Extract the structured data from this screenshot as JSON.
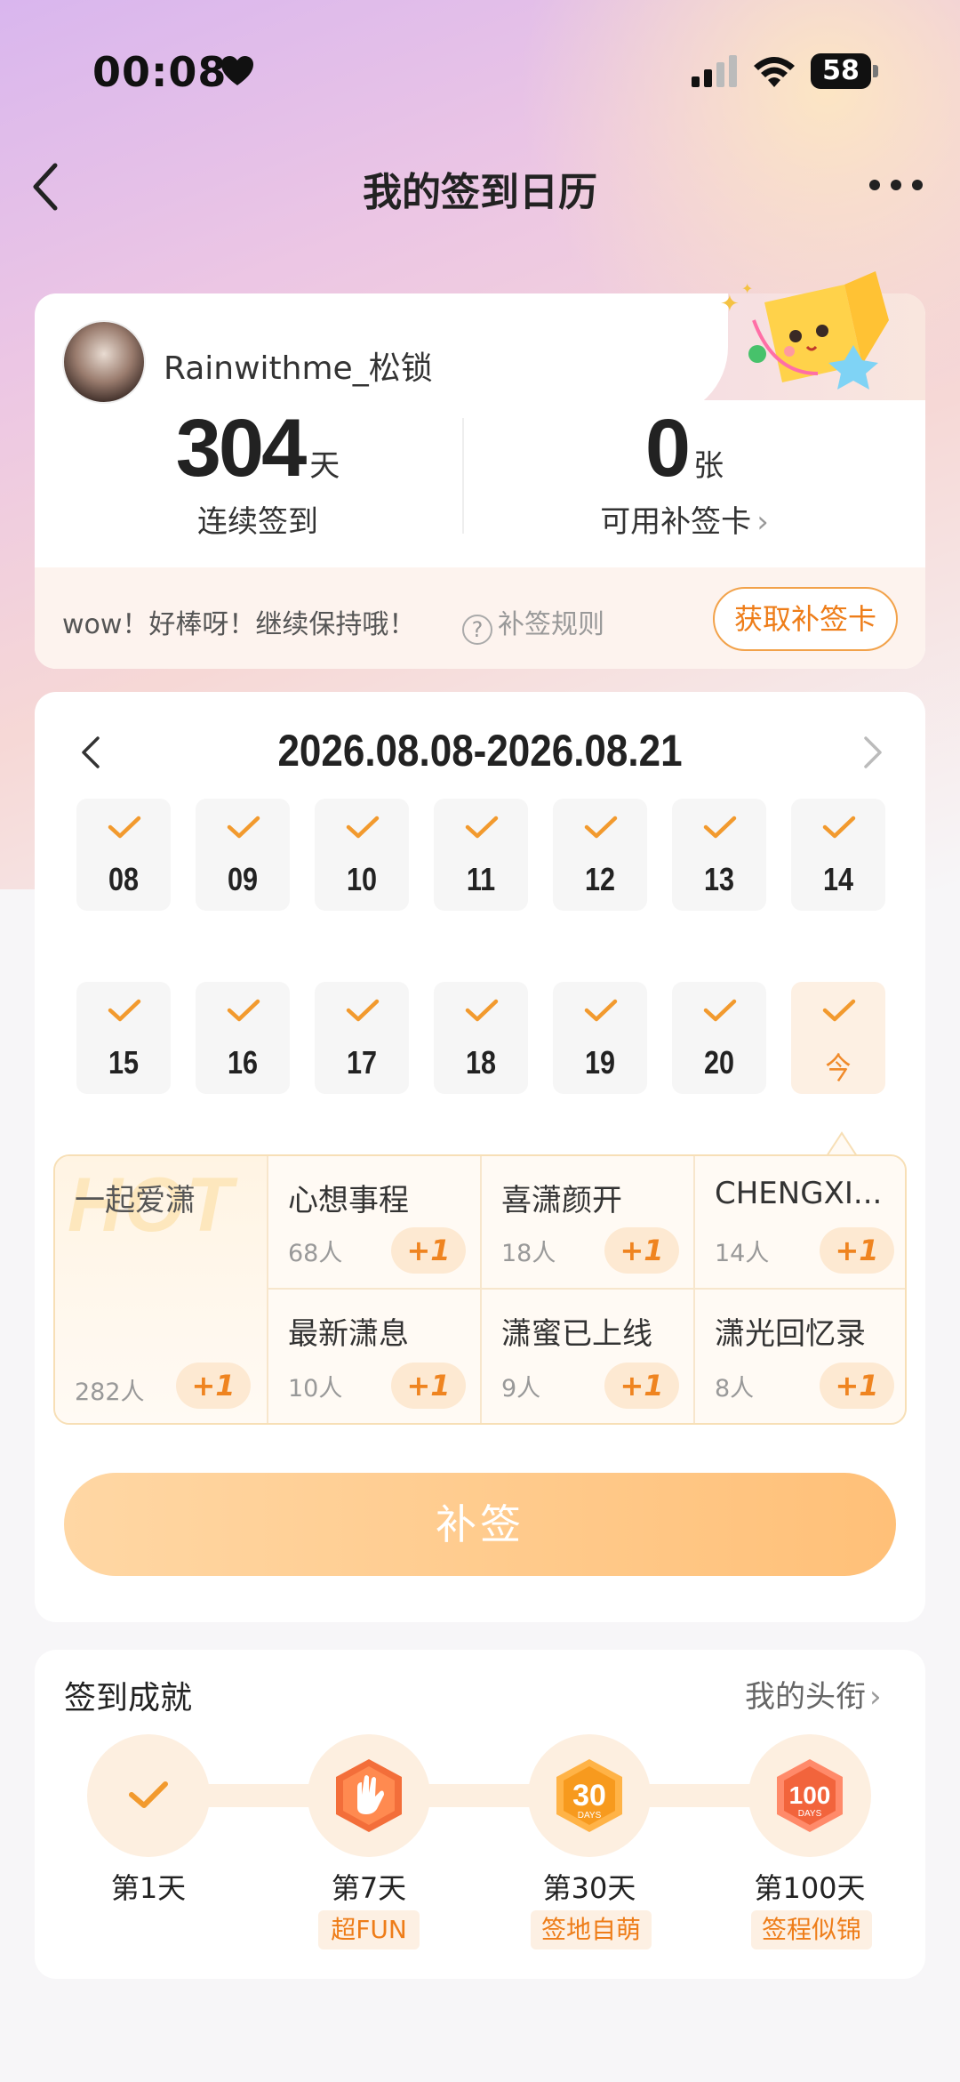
{
  "status_bar": {
    "time": "00:08",
    "battery": "58"
  },
  "nav": {
    "title": "我的签到日历"
  },
  "profile": {
    "username": "Rainwithme_松锁",
    "streak_value": "304",
    "streak_unit": "天",
    "streak_label": "连续签到",
    "cards_value": "0",
    "cards_unit": "张",
    "cards_label": "可用补签卡",
    "tip": "wow！好棒呀！继续保持哦！",
    "rules_label": "补签规则",
    "get_card_button": "获取补签卡"
  },
  "calendar": {
    "range": "2026.08.08-2026.08.21",
    "week1": [
      "08",
      "09",
      "10",
      "11",
      "12",
      "13",
      "14"
    ],
    "week2": [
      "15",
      "16",
      "17",
      "18",
      "19",
      "20",
      "今"
    ]
  },
  "topics": {
    "hot_watermark": "HOT",
    "hot": {
      "name": "一起爱潇",
      "count": "282人",
      "plus": "+1"
    },
    "items": [
      {
        "name": "心想事程",
        "count": "68人",
        "plus": "+1"
      },
      {
        "name": "喜潇颜开",
        "count": "18人",
        "plus": "+1"
      },
      {
        "name": "CHENGXI...",
        "count": "14人",
        "plus": "+1"
      },
      {
        "name": "最新潇息",
        "count": "10人",
        "plus": "+1"
      },
      {
        "name": "潇蜜已上线",
        "count": "9人",
        "plus": "+1"
      },
      {
        "name": "潇光回忆录",
        "count": "8人",
        "plus": "+1"
      }
    ]
  },
  "sign_button": "补签",
  "achievements": {
    "title": "签到成就",
    "link": "我的头衔",
    "items": [
      {
        "label": "第1天",
        "tag": ""
      },
      {
        "label": "第7天",
        "tag": "超FUN"
      },
      {
        "label": "第30天",
        "tag": "签地自萌"
      },
      {
        "label": "第100天",
        "tag": "签程似锦"
      }
    ]
  },
  "colors": {
    "accent": "#f08a2a",
    "sign_button": "#ffc078"
  }
}
